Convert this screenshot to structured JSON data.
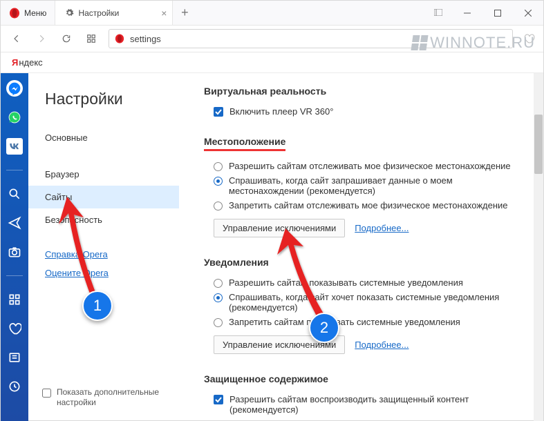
{
  "titlebar": {
    "menu": "Меню",
    "tab_title": "Настройки"
  },
  "address": {
    "text": "settings"
  },
  "yandex": {
    "y": "Я",
    "text": "ндекс"
  },
  "watermark": "WINNOTE.RU",
  "sidebar": {
    "title": "Настройки",
    "items": [
      {
        "label": "Основные",
        "active": false
      },
      {
        "label": "Браузер",
        "active": false
      },
      {
        "label": "Сайты",
        "active": true
      },
      {
        "label": "Безопасность",
        "active": false
      }
    ],
    "links": [
      {
        "label": "Справка Opera"
      },
      {
        "label": "Оцените Opera"
      }
    ],
    "footer": "Показать дополнительные настройки"
  },
  "sections": {
    "vr": {
      "title": "Виртуальная реальность",
      "check": "Включить плеер VR 360°"
    },
    "location": {
      "title": "Местоположение",
      "opts": [
        "Разрешить сайтам отслеживать мое физическое местонахождение",
        "Спрашивать, когда сайт запрашивает данные о моем местонахождении (рекомендуется)",
        "Запретить сайтам отслеживать мое физическое местонахождение"
      ],
      "btn": "Управление исключениями",
      "more": "Подробнее..."
    },
    "notif": {
      "title": "Уведомления",
      "opts": [
        "Разрешить сайтам показывать системные уведомления",
        "Спрашивать, когда сайт хочет показать системные уведомления (рекомендуется)",
        "Запретить сайтам показывать системные уведомления"
      ],
      "btn": "Управление исключениями",
      "more": "Подробнее..."
    },
    "protected": {
      "title": "Защищенное содержимое",
      "check": "Разрешить сайтам воспроизводить защищенный контент (рекомендуется)"
    }
  },
  "badges": {
    "one": "1",
    "two": "2"
  }
}
